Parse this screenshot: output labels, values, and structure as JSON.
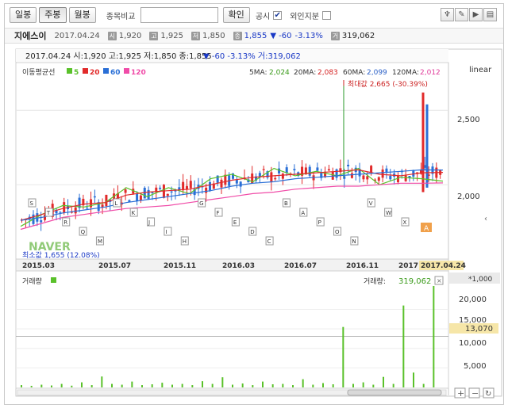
{
  "toolbar": {
    "period_buttons": [
      "일봉",
      "주봉",
      "월봉"
    ],
    "compare_label": "종목비교",
    "compare_input": "",
    "confirm_button": "확인",
    "disclosure_label": "공시",
    "foreign_label": "외인지분",
    "disclosure_checked": true,
    "foreign_checked": false
  },
  "info": {
    "name": "지에스이",
    "date": "2017.04.24",
    "open_label": "시",
    "open": "1,920",
    "high_label": "고",
    "high": "1,925",
    "low_label": "저",
    "low": "1,850",
    "close_label": "종",
    "close": "1,855",
    "change": "▼ -60",
    "change_pct": "-3.13%",
    "volume_label": "거",
    "volume": "319,062"
  },
  "chart_header": {
    "line": "2017.04.24  시:1,920  고:1,925  저:1,850  종:1,855",
    "change": "▼  -60  -3.13%  거:319,062"
  },
  "ma_legend": {
    "title": "이동평균선",
    "periods": [
      "5",
      "20",
      "60",
      "120"
    ],
    "colors": [
      "#5ac12a",
      "#e12a2a",
      "#2a6fd6",
      "#f04ca8"
    ],
    "values": [
      {
        "label": "5MA:",
        "value": "2,024",
        "color": "#3a9a1a"
      },
      {
        "label": "20MA:",
        "value": "2,083",
        "color": "#d42020"
      },
      {
        "label": "60MA:",
        "value": "2,099",
        "color": "#2a5fc6"
      },
      {
        "label": "120MA:",
        "value": "2,012",
        "color": "#e03a9a"
      }
    ]
  },
  "scale_label": "linear",
  "price_axis": [
    "2,500",
    "2,000"
  ],
  "annotations": {
    "max_label": "최대값 2,665 (-30.39%)",
    "min_label": "최소값 1,655 (12.08%)",
    "watermark": "NAVER",
    "current_marker": "A"
  },
  "date_axis": [
    "2015.03",
    "2015.07",
    "2015.11",
    "2016.03",
    "2016.07",
    "2016.11",
    "2017",
    "2017.04.24"
  ],
  "volume_panel": {
    "title": "거래량",
    "label": "거래량:",
    "value": "319,062",
    "multiplier": "*1,000",
    "axis": [
      "20,000",
      "15,000",
      "10,000",
      "5,000"
    ],
    "current_level": "13,070"
  },
  "event_labels": [
    "S",
    "T",
    "R",
    "Q",
    "M",
    "L",
    "K",
    "J",
    "I",
    "H",
    "G",
    "F",
    "E",
    "D",
    "C",
    "B",
    "A",
    "P",
    "O",
    "N",
    "V",
    "W",
    "X"
  ],
  "chart_data": [
    {
      "type": "line",
      "title": "",
      "xlabel": "",
      "ylabel": "",
      "ylim": [
        1500,
        2800
      ],
      "x_ticks": [
        "2015.03",
        "2015.07",
        "2015.11",
        "2016.03",
        "2016.07",
        "2016.11",
        "2017",
        "2017.04.24"
      ],
      "series": [
        {
          "name": "5",
          "color": "#5ac12a",
          "values": [
            1720,
            1800,
            1860,
            1850,
            1880,
            1980,
            1920,
            1980,
            1940,
            2040,
            2070,
            2020,
            2110,
            2060,
            2090,
            2060,
            2110,
            2000,
            2050,
            2040,
            2024
          ]
        },
        {
          "name": "20",
          "color": "#e12a2a",
          "values": [
            1760,
            1800,
            1840,
            1870,
            1880,
            1930,
            1950,
            1960,
            1970,
            2000,
            2030,
            2050,
            2060,
            2070,
            2080,
            2090,
            2100,
            2070,
            2060,
            2080,
            2083
          ]
        },
        {
          "name": "60",
          "color": "#2a6fd6",
          "values": [
            1760,
            1780,
            1810,
            1830,
            1850,
            1880,
            1900,
            1920,
            1940,
            1960,
            1990,
            2010,
            2020,
            2040,
            2050,
            2060,
            2070,
            2080,
            2090,
            2100,
            2099
          ]
        },
        {
          "name": "120",
          "color": "#f04ca8",
          "values": [
            1700,
            1740,
            1780,
            1800,
            1820,
            1840,
            1850,
            1860,
            1880,
            1900,
            1920,
            1940,
            1950,
            1970,
            1980,
            1990,
            1990,
            2000,
            2010,
            2010,
            2012
          ]
        }
      ],
      "max": 2665,
      "min": 1655,
      "last": 1855
    },
    {
      "type": "bar",
      "title": "",
      "series_name": "",
      "ylim": [
        0,
        26000
      ],
      "values": [
        600,
        400,
        700,
        500,
        900,
        450,
        1300,
        600,
        2800,
        900,
        700,
        1500,
        600,
        800,
        1200,
        700,
        900,
        600,
        1600,
        900,
        2600,
        700,
        1000,
        600,
        1500,
        800,
        900,
        600,
        2100,
        700,
        1100,
        800,
        15500,
        900,
        1300,
        700,
        2700,
        900,
        21000,
        3800,
        900,
        319062
      ]
    }
  ]
}
